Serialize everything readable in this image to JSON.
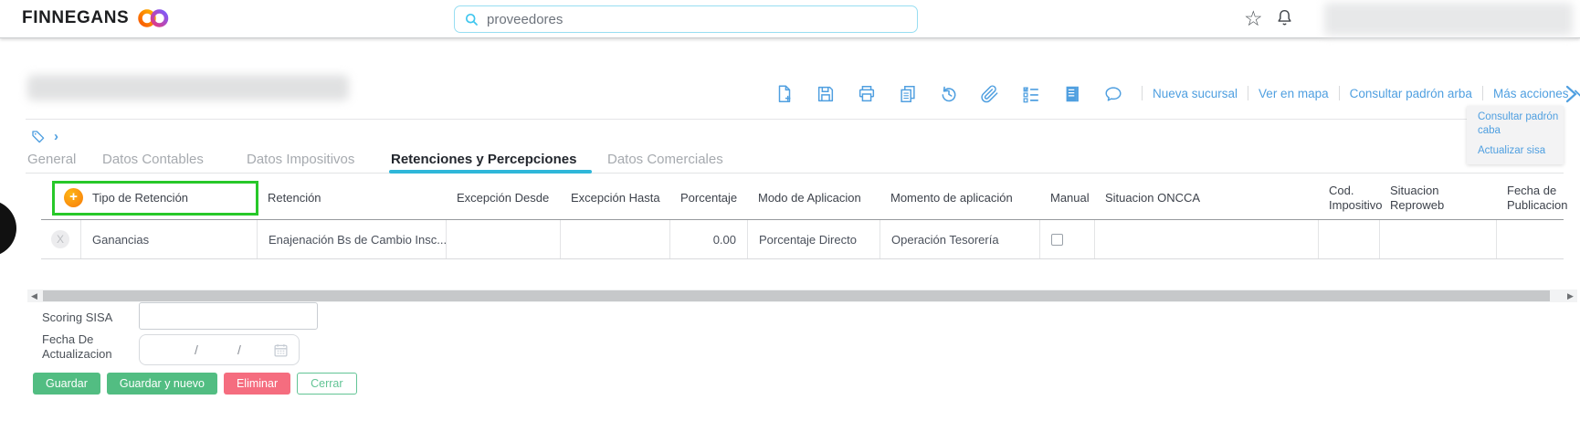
{
  "topbar": {
    "brand": "FINNEGANS",
    "search_value": "proveedores"
  },
  "toolbar": {
    "icons": [
      "new-document",
      "save",
      "print",
      "copy",
      "history",
      "attachment",
      "checklist",
      "report",
      "comments"
    ]
  },
  "actions": {
    "links": [
      "Nueva sucursal",
      "Ver en mapa",
      "Consultar padrón arba"
    ],
    "more_label": "Más acciones",
    "dropdown": [
      "Consultar padrón caba",
      "Actualizar sisa"
    ]
  },
  "tabs": [
    {
      "label": "General"
    },
    {
      "label": "Datos Contables"
    },
    {
      "label": "Datos Impositivos"
    },
    {
      "label": "Retenciones y Percepciones",
      "active": true
    },
    {
      "label": "Datos Comerciales"
    }
  ],
  "table": {
    "headers": [
      {
        "l1": "Tipo de Retención",
        "l2": ""
      },
      {
        "l1": "Retención",
        "l2": ""
      },
      {
        "l1": "Excepción Desde",
        "l2": ""
      },
      {
        "l1": "Excepción Hasta",
        "l2": ""
      },
      {
        "l1": "Porcentaje",
        "l2": ""
      },
      {
        "l1": "Modo de Aplicacion",
        "l2": ""
      },
      {
        "l1": "Momento de aplicación",
        "l2": ""
      },
      {
        "l1": "Manual",
        "l2": ""
      },
      {
        "l1": "Situacion ONCCA",
        "l2": ""
      },
      {
        "l1": "Cod.",
        "l2": "Impositivo"
      },
      {
        "l1": "Situacion",
        "l2": "Reproweb"
      },
      {
        "l1": "Fecha de",
        "l2": "Publicacion"
      }
    ],
    "row": {
      "delete_glyph": "X",
      "tipo": "Ganancias",
      "retencion": "Enajenación Bs de Cambio Insc...",
      "excepcion_desde": "",
      "excepcion_hasta": "",
      "porcentaje": "0.00",
      "modo": "Porcentaje Directo",
      "momento": "Operación Tesorería",
      "manual_checked": false,
      "situacion_oncca": "",
      "cod_impositivo": "",
      "situacion_reproweb": "",
      "fecha_publicacion": ""
    }
  },
  "fields": {
    "scoring_label": "Scoring SISA",
    "scoring_value": "",
    "fecha_label_1": "Fecha De",
    "fecha_label_2": "Actualizacion",
    "date_separator": "/"
  },
  "buttons": {
    "save": "Guardar",
    "save_new": "Guardar y nuevo",
    "delete": "Eliminar",
    "close": "Cerrar"
  },
  "colors": {
    "accent_blue": "#4f9fe0",
    "search_cyan": "#3fc6ee",
    "tab_underline": "#2fb7d9",
    "annotation_green": "#27c829",
    "plus_orange": "#f97b0b",
    "button_green": "#52bd82",
    "button_red": "#f56d7f",
    "button_close_border": "#62c495"
  }
}
